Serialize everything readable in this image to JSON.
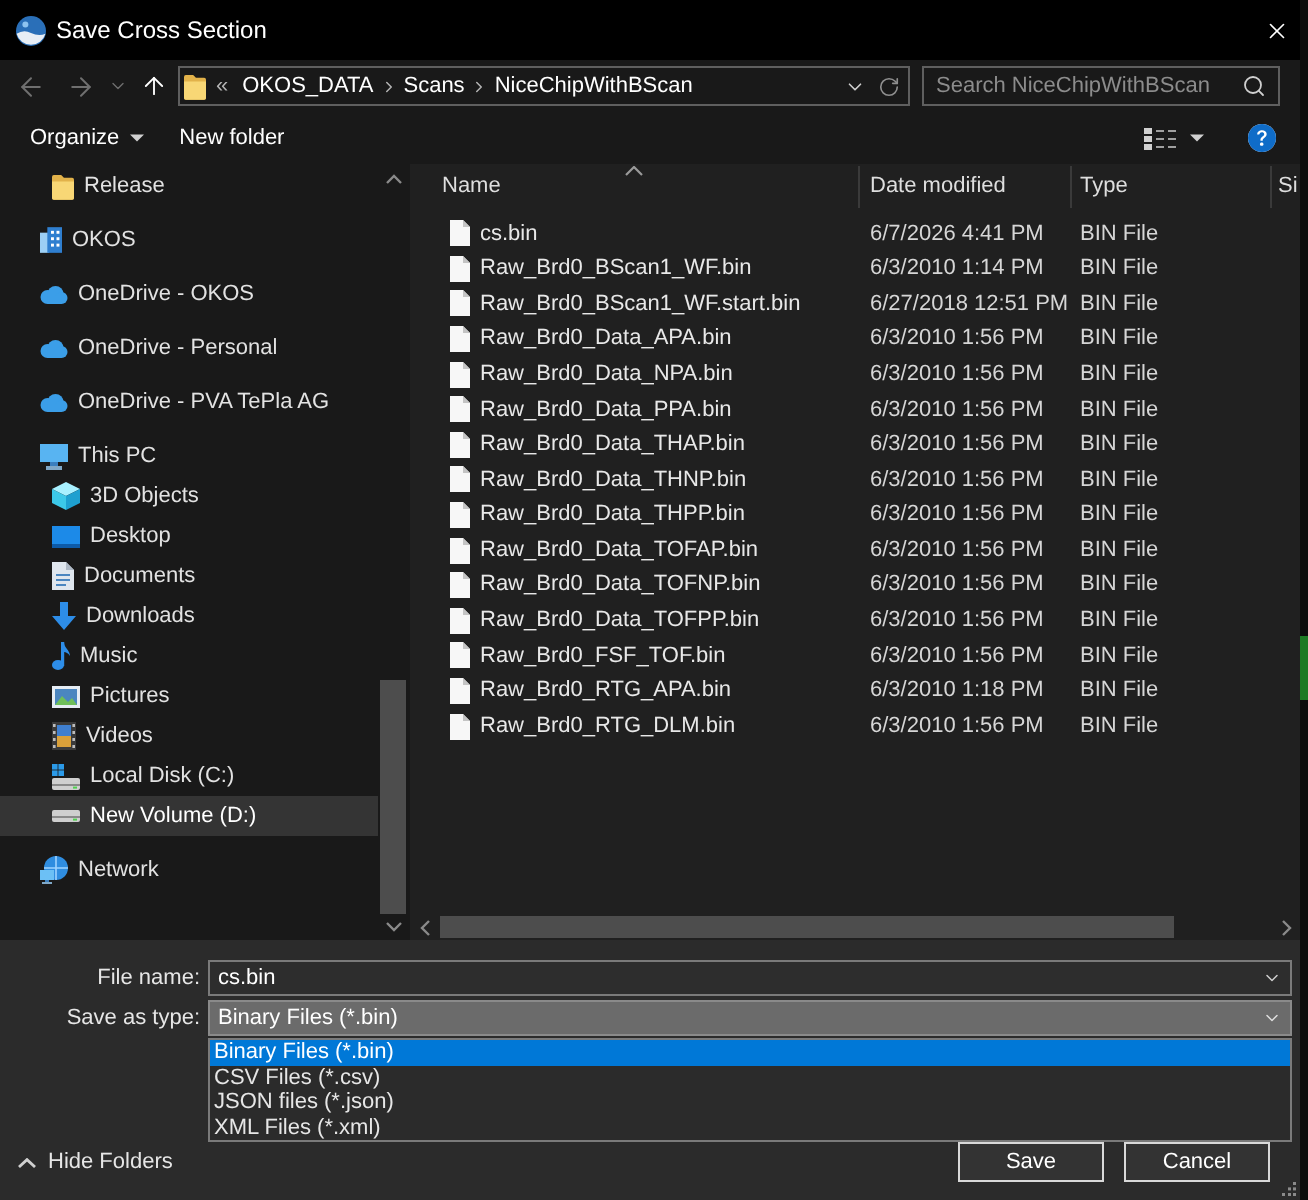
{
  "window": {
    "title": "Save Cross Section"
  },
  "navigation": [
    {
      "kind": "back",
      "disabled": true
    },
    {
      "kind": "forward",
      "disabled": true
    },
    {
      "kind": "recent",
      "disabled": true
    },
    {
      "kind": "up",
      "disabled": false
    }
  ],
  "address_bar": {
    "overflow": "«",
    "path": [
      "OKOS_DATA",
      "Scans",
      "NiceChipWithBScan"
    ]
  },
  "search": {
    "placeholder": "Search NiceChipWithBScan"
  },
  "toolbar": {
    "organize": "Organize",
    "new_folder": "New folder"
  },
  "sidebar": {
    "items": [
      {
        "children": [
          {
            "label": "Release",
            "kind": "folder",
            "selected": false
          }
        ]
      },
      {
        "label": "OKOS",
        "kind": "site",
        "selected": false
      },
      {
        "label": "OneDrive - OKOS",
        "kind": "cloud",
        "selected": false
      },
      {
        "label": "OneDrive - Personal",
        "kind": "cloud",
        "selected": false
      },
      {
        "label": "OneDrive - PVA TePla AG",
        "kind": "cloud",
        "selected": false
      },
      {
        "label": "This PC",
        "kind": "computer",
        "selected": false,
        "children": [
          {
            "label": "3D Objects",
            "kind": "objects",
            "selected": false
          },
          {
            "label": "Desktop",
            "kind": "desktop",
            "selected": false
          },
          {
            "label": "Documents",
            "kind": "documents",
            "selected": false
          },
          {
            "label": "Downloads",
            "kind": "downloads",
            "selected": false
          },
          {
            "label": "Music",
            "kind": "music",
            "selected": false
          },
          {
            "label": "Pictures",
            "kind": "pictures",
            "selected": false
          },
          {
            "label": "Videos",
            "kind": "videos",
            "selected": false
          },
          {
            "label": "Local Disk (C:)",
            "kind": "disk",
            "selected": false
          },
          {
            "label": "New Volume (D:)",
            "kind": "volume",
            "selected": true
          }
        ]
      },
      {
        "label": "Network",
        "kind": "network",
        "selected": false
      }
    ]
  },
  "file_list": {
    "columns": [
      {
        "label": "Name",
        "sorted": true
      },
      {
        "label": "Date modified",
        "sorted": false
      },
      {
        "label": "Type",
        "sorted": false
      },
      {
        "label": "Si",
        "sorted": false
      }
    ],
    "rows": [
      {
        "name": "cs.bin",
        "date_modified": "6/7/2026 4:41 PM",
        "type": "BIN File"
      },
      {
        "name": "Raw_Brd0_BScan1_WF.bin",
        "date_modified": "6/3/2010 1:14 PM",
        "type": "BIN File"
      },
      {
        "name": "Raw_Brd0_BScan1_WF.start.bin",
        "date_modified": "6/27/2018 12:51 PM",
        "type": "BIN File"
      },
      {
        "name": "Raw_Brd0_Data_APA.bin",
        "date_modified": "6/3/2010 1:56 PM",
        "type": "BIN File"
      },
      {
        "name": "Raw_Brd0_Data_NPA.bin",
        "date_modified": "6/3/2010 1:56 PM",
        "type": "BIN File"
      },
      {
        "name": "Raw_Brd0_Data_PPA.bin",
        "date_modified": "6/3/2010 1:56 PM",
        "type": "BIN File"
      },
      {
        "name": "Raw_Brd0_Data_THAP.bin",
        "date_modified": "6/3/2010 1:56 PM",
        "type": "BIN File"
      },
      {
        "name": "Raw_Brd0_Data_THNP.bin",
        "date_modified": "6/3/2010 1:56 PM",
        "type": "BIN File"
      },
      {
        "name": "Raw_Brd0_Data_THPP.bin",
        "date_modified": "6/3/2010 1:56 PM",
        "type": "BIN File"
      },
      {
        "name": "Raw_Brd0_Data_TOFAP.bin",
        "date_modified": "6/3/2010 1:56 PM",
        "type": "BIN File"
      },
      {
        "name": "Raw_Brd0_Data_TOFNP.bin",
        "date_modified": "6/3/2010 1:56 PM",
        "type": "BIN File"
      },
      {
        "name": "Raw_Brd0_Data_TOFPP.bin",
        "date_modified": "6/3/2010 1:56 PM",
        "type": "BIN File"
      },
      {
        "name": "Raw_Brd0_FSF_TOF.bin",
        "date_modified": "6/3/2010 1:56 PM",
        "type": "BIN File"
      },
      {
        "name": "Raw_Brd0_RTG_APA.bin",
        "date_modified": "6/3/2010 1:18 PM",
        "type": "BIN File"
      },
      {
        "name": "Raw_Brd0_RTG_DLM.bin",
        "date_modified": "6/3/2010 1:56 PM",
        "type": "BIN File"
      }
    ]
  },
  "file_name": {
    "label": "File name:",
    "value": "cs.bin"
  },
  "save_as_type": {
    "label": "Save as type:",
    "value": "Binary Files (*.bin)",
    "expanded": true,
    "options": [
      {
        "label": "Binary Files (*.bin)",
        "selected": true
      },
      {
        "label": "CSV Files (*.csv)",
        "selected": false
      },
      {
        "label": "JSON files (*.json)",
        "selected": false
      },
      {
        "label": "XML Files (*.xml)",
        "selected": false
      }
    ]
  },
  "hide_folders": "Hide Folders",
  "buttons": [
    {
      "label": "Save"
    },
    {
      "label": "Cancel"
    }
  ]
}
